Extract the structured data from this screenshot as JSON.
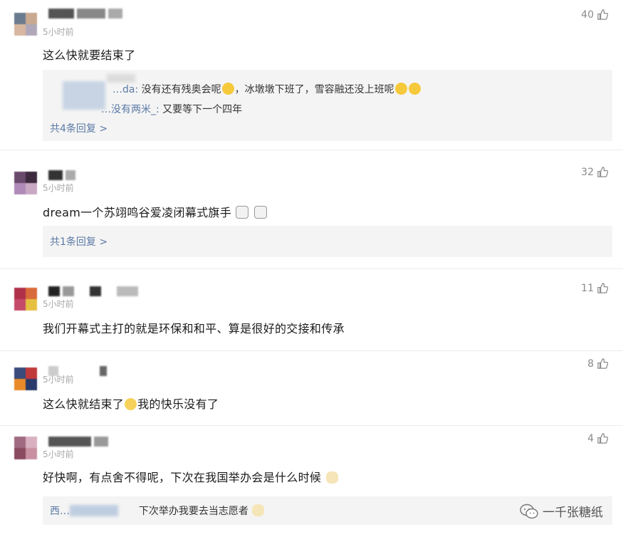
{
  "comments": [
    {
      "time": "5小时前",
      "likes": "40",
      "text": "这么快就要结束了",
      "replies": [
        {
          "name": "…da:",
          "text": "没有还有残奥会呢",
          "text2": "，冰墩墩下班了，雪容融还没上班呢"
        },
        {
          "name": "…没有两米_:",
          "text": "又要等下一个四年"
        }
      ],
      "more": "共4条回复 >"
    },
    {
      "name_fragment": "东组",
      "time": "5小时前",
      "likes": "32",
      "text": "dream一个苏翊鸣谷爱凌闭幕式旗手",
      "more": "共1条回复 >"
    },
    {
      "time": "5小时前",
      "likes": "11",
      "text": "我们开幕式主打的就是环保和和平、算是很好的交接和传承"
    },
    {
      "time": "5小时前",
      "likes": "8",
      "text": "这么快就结束了",
      "text2": "我的快乐没有了"
    },
    {
      "time": "5小时前",
      "likes": "4",
      "text": "好快啊，有点舍不得呢，下次在我国举办会是什么时候",
      "reply": {
        "name": "西…",
        "text": "下次举办我要去当志愿者"
      }
    }
  ],
  "watermark": "一千张糖纸",
  "colors": {
    "link": "#5b7aa6",
    "time": "#a8a8a8",
    "reply_bg": "#f4f4f4"
  }
}
